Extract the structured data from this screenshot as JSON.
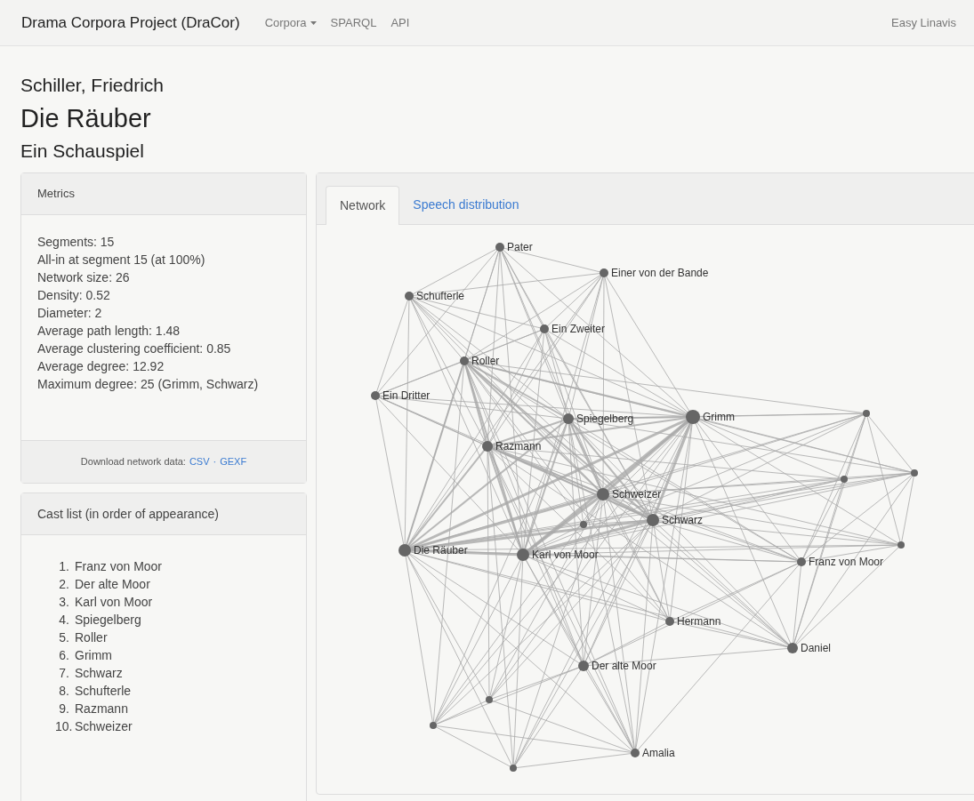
{
  "navbar": {
    "brand": "Drama Corpora Project (DraCor)",
    "links": [
      {
        "label": "Corpora",
        "dropdown": true
      },
      {
        "label": "SPARQL",
        "dropdown": false
      },
      {
        "label": "API",
        "dropdown": false
      }
    ],
    "right_link": "Easy Linavis"
  },
  "author": "Schiller, Friedrich",
  "title": "Die Räuber",
  "subtitle": "Ein Schauspiel",
  "metrics": {
    "heading": "Metrics",
    "items": [
      "Segments: 15",
      "All-in at segment 15 (at 100%)",
      "Network size: 26",
      "Density: 0.52",
      "Diameter: 2",
      "Average path length: 1.48",
      "Average clustering coefficient: 0.85",
      "Average degree: 12.92",
      "Maximum degree: 25 (Grimm, Schwarz)"
    ],
    "download_label": "Download network data:",
    "download_links": [
      "CSV",
      "GEXF"
    ],
    "separator": "·"
  },
  "cast": {
    "heading": "Cast list (in order of appearance)",
    "items": [
      {
        "number": "1.",
        "name": "Franz von Moor"
      },
      {
        "number": "2.",
        "name": "Der alte Moor"
      },
      {
        "number": "3.",
        "name": "Karl von Moor"
      },
      {
        "number": "4.",
        "name": "Spiegelberg"
      },
      {
        "number": "5.",
        "name": "Roller"
      },
      {
        "number": "6.",
        "name": "Grimm"
      },
      {
        "number": "7.",
        "name": "Schwarz"
      },
      {
        "number": "8.",
        "name": "Schufterle"
      },
      {
        "number": "9.",
        "name": "Razmann"
      },
      {
        "number": "10.",
        "name": "Schweizer"
      }
    ]
  },
  "tabs": [
    {
      "label": "Network",
      "selected": true
    },
    {
      "label": "Speech distribution",
      "selected": false
    }
  ],
  "network": {
    "nodes": [
      {
        "label": "Pater"
      },
      {
        "label": "Einer von der Bande"
      },
      {
        "label": "Schufterle"
      },
      {
        "label": "Ein Zweiter"
      },
      {
        "label": "Roller"
      },
      {
        "label": "Ein Dritter"
      },
      {
        "label": "Spiegelberg"
      },
      {
        "label": "Grimm"
      },
      {
        "label": "Razmann"
      },
      {
        "label": "Schweizer"
      },
      {
        "label": "Schwarz"
      },
      {
        "label": "Die Räuber"
      },
      {
        "label": "Karl von Moor"
      },
      {
        "label": "Franz von Moor"
      },
      {
        "label": "Hermann"
      },
      {
        "label": "Daniel"
      },
      {
        "label": "Der alte Moor"
      },
      {
        "label": "Amalia"
      }
    ]
  }
}
